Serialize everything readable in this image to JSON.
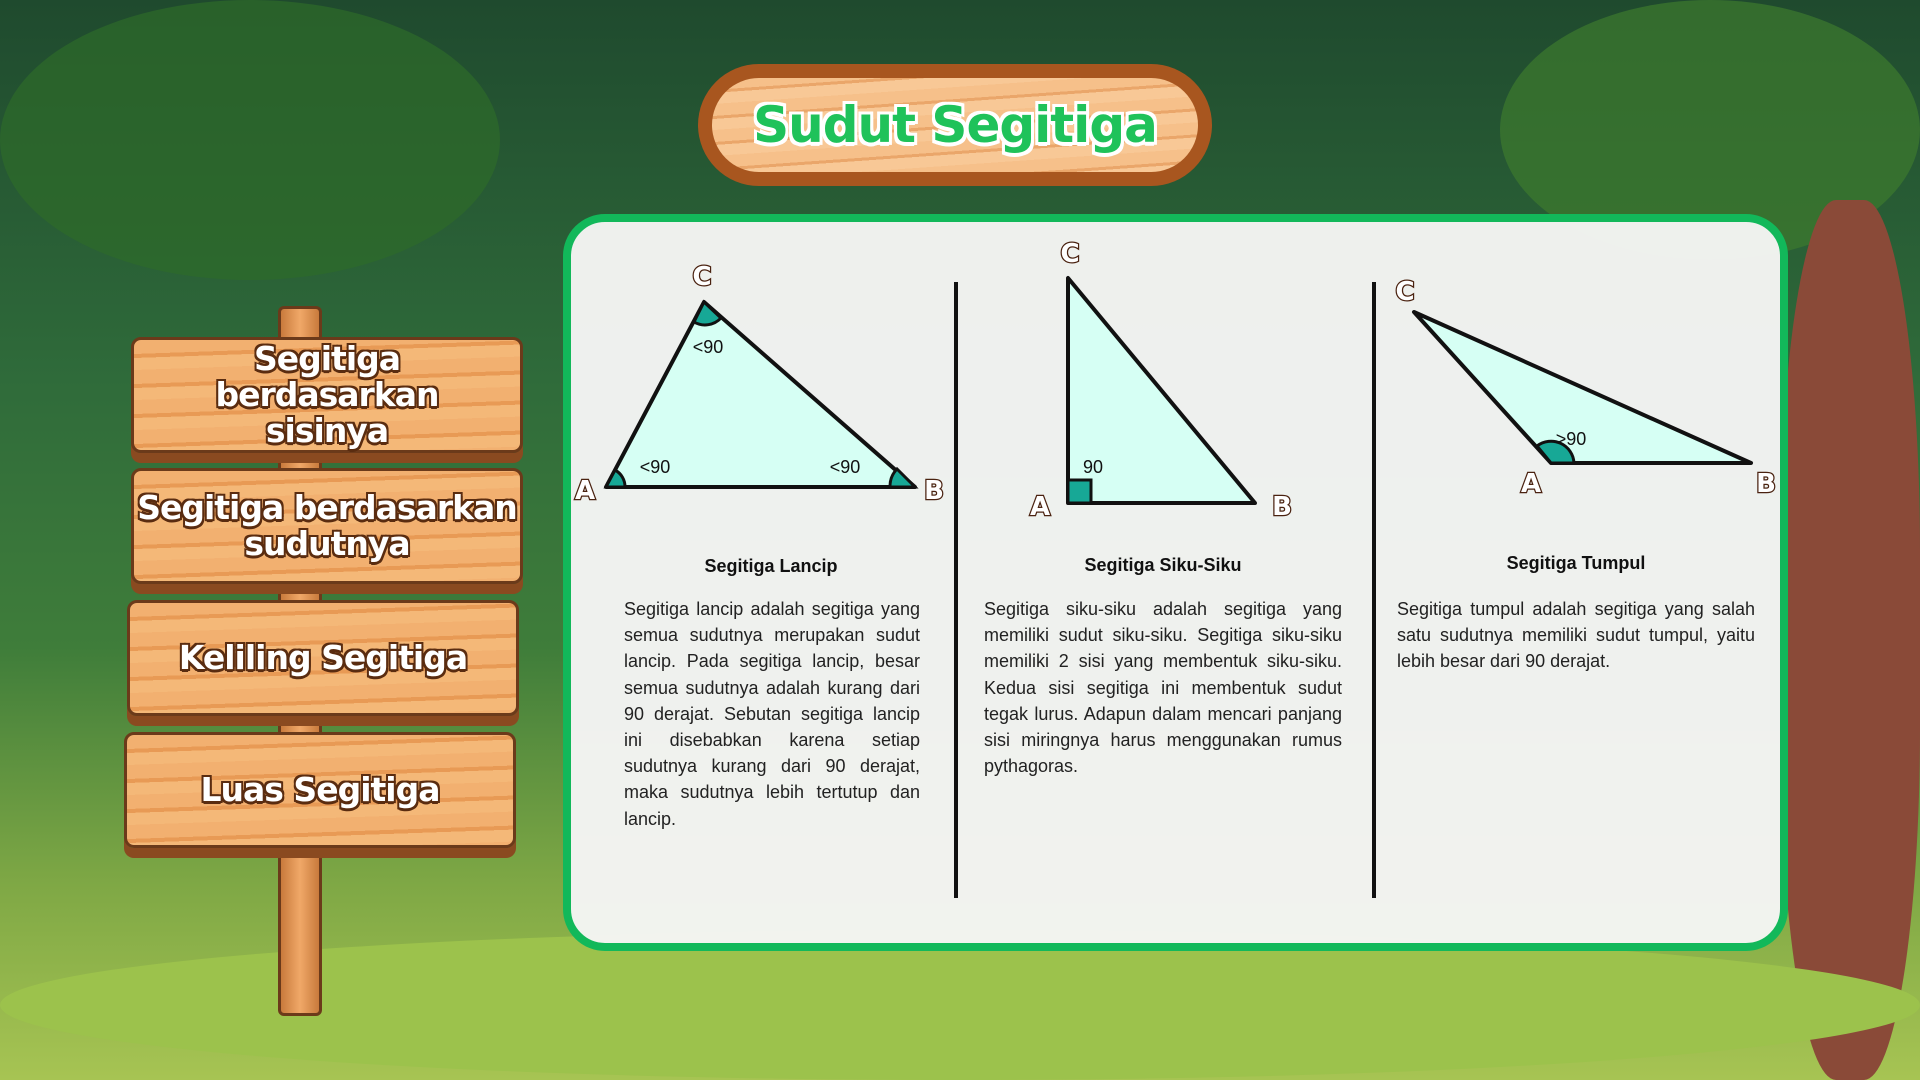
{
  "header": {
    "title": "Sudut Segitiga"
  },
  "menu": [
    {
      "label": "Segitiga berdasarkan sisinya"
    },
    {
      "label": "Segitiga berdasarkan sudutnya"
    },
    {
      "label": "Keliling Segitiga"
    },
    {
      "label": "Luas Segitiga"
    }
  ],
  "colors": {
    "accent": "#12b85a",
    "triangle_fill": "#d6fff4",
    "angle_fill": "#17a896"
  },
  "sections": [
    {
      "title": "Segitiga Lancip",
      "text": "Segitiga lancip adalah segitiga yang semua sudutnya merupakan sudut lancip. Pada segitiga lancip, besar semua sudutnya adalah kurang dari 90 derajat. Sebutan segitiga lancip ini disebabkan karena setiap sudutnya kurang dari 90 derajat, maka sudutnya lebih tertutup dan lancip.",
      "vertices": {
        "a": "A",
        "b": "B",
        "c": "C"
      },
      "angles": {
        "a": "<90",
        "b": "<90",
        "c": "<90"
      }
    },
    {
      "title": "Segitiga Siku-Siku",
      "text": "Segitiga siku-siku adalah segitiga yang memiliki sudut siku-siku. Segitiga siku-siku memiliki 2 sisi yang membentuk siku-siku. Kedua sisi segitiga ini membentuk sudut tegak lurus. Adapun dalam mencari panjang sisi miringnya harus menggunakan rumus pythagoras.",
      "vertices": {
        "a": "A",
        "b": "B",
        "c": "C"
      },
      "angles": {
        "a": "90"
      }
    },
    {
      "title": "Segitiga Tumpul",
      "text": "Segitiga tumpul adalah segitiga yang salah satu sudutnya memiliki sudut tumpul, yaitu lebih besar dari 90 derajat.",
      "vertices": {
        "a": "A",
        "b": "B",
        "c": "C"
      },
      "angles": {
        "a": ">90"
      }
    }
  ]
}
